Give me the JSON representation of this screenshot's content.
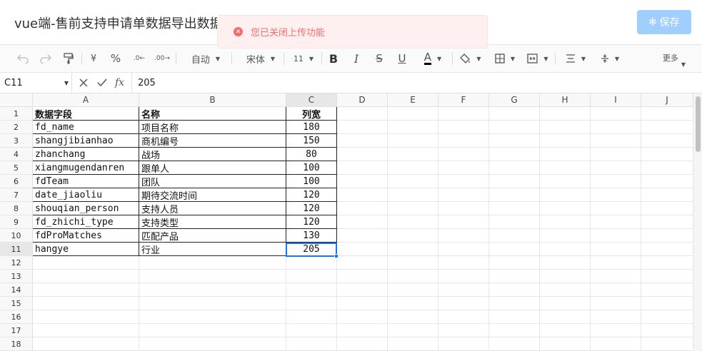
{
  "header": {
    "title": "vue端-售前支持申请单数据导出数据",
    "save_label": "保存",
    "save_icon": "gear-icon"
  },
  "toast": {
    "message": "您已关闭上传功能",
    "type": "error",
    "color": "#f56c6c"
  },
  "toolbar": {
    "undo_icon": "undo-icon",
    "redo_icon": "redo-icon",
    "format_painter_icon": "format-painter-icon",
    "currency": "¥",
    "percent": "%",
    "decimal_less": ".0←",
    "decimal_more": ".00→",
    "number_format": "自动",
    "font_family": "宋体",
    "font_size": "11",
    "bold": "B",
    "italic": "I",
    "strike": "S",
    "underline": "U",
    "text_color": "A",
    "more_label": "更多"
  },
  "formula_bar": {
    "cell_ref": "C11",
    "cancel_icon": "close-icon",
    "confirm_icon": "check-icon",
    "fx_label": "fx",
    "value": "205"
  },
  "sheet": {
    "columns": [
      "A",
      "B",
      "C",
      "D",
      "E",
      "F",
      "G",
      "H",
      "I",
      "J"
    ],
    "rows": [
      "1",
      "2",
      "3",
      "4",
      "5",
      "6",
      "7",
      "8",
      "9",
      "10",
      "11",
      "12",
      "13",
      "14",
      "15",
      "16",
      "17",
      "18"
    ],
    "selected_cell": "C11",
    "data": [
      [
        "数据字段",
        "名称",
        "列宽"
      ],
      [
        "fd_name",
        "项目名称",
        "180"
      ],
      [
        "shangjibianhao",
        "商机编号",
        "150"
      ],
      [
        "zhanchang",
        "战场",
        "80"
      ],
      [
        "xiangmugendanren",
        "跟单人",
        "100"
      ],
      [
        "fdTeam",
        "团队",
        "100"
      ],
      [
        "date_jiaoliu",
        "期待交流时间",
        "120"
      ],
      [
        "shouqian_person",
        "支持人员",
        "120"
      ],
      [
        "fd_zhichi_type",
        "支持类型",
        "120"
      ],
      [
        "fdProMatches",
        "匹配产品",
        "130"
      ],
      [
        "hangye",
        "行业",
        "205"
      ]
    ]
  },
  "colors": {
    "accent": "#1a73e8",
    "save_button": "#a0cfff",
    "toast_bg": "#fef0f0"
  }
}
